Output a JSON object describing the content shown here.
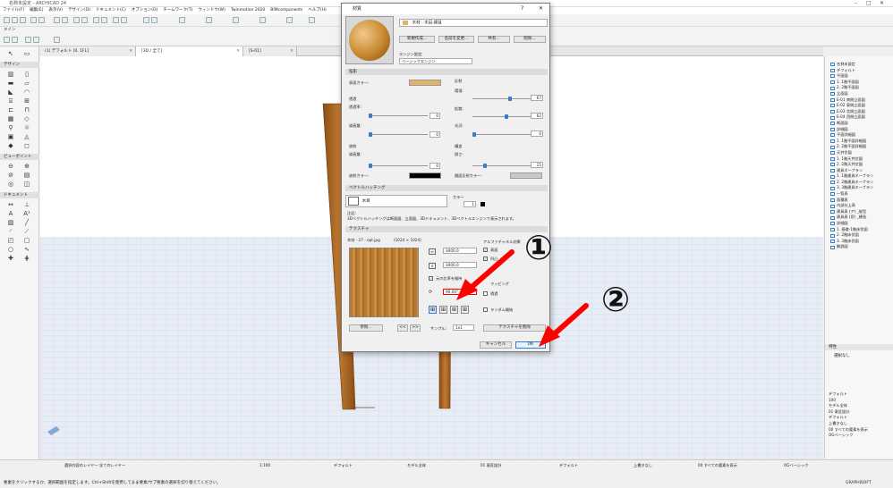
{
  "app": {
    "title": "名称未設定 - ARCHICAD 24"
  },
  "menu": [
    "ファイル(F)",
    "編集(E)",
    "表示(V)",
    "デザイン(D)",
    "ドキュメント(C)",
    "オプション(O)",
    "チームワーク(T)",
    "ウィンドウ(W)",
    "Twinmotion 2020",
    "BIMcomponents",
    "ヘルプ(H)"
  ],
  "toolbar2": {
    "label": "メイン"
  },
  "tabs": [
    {
      "label": "[0. 1FL]",
      "prefix": "(1) デフォルト"
    },
    {
      "label": "[3D / 全て]"
    },
    {
      "label": "[S-01]"
    }
  ],
  "leftpanel": {
    "design": "デザイン",
    "viewpoint": "ビューポイント",
    "document": "ドキュメント"
  },
  "dialog": {
    "title": "材質",
    "material_name": "木材 - 木目-細目",
    "buttons": {
      "new": "新規作成...",
      "rename": "名前を変更...",
      "share": "共有...",
      "delete": "削除..."
    },
    "engine_label": "エンジン設定:",
    "engine_value": "ベーシックエンジン",
    "sections": {
      "appearance": "陰影",
      "hatch": "ベクトルハッチング",
      "texture": "テクスチャ"
    },
    "appearance": {
      "surface_color": "表面カラー:",
      "transparency": "透過",
      "transparency_rate": "透過率:",
      "attenuation": "減衰量:",
      "transparency_val": "0",
      "atten_val": "0",
      "reflection": "反射",
      "glossy": "環境:",
      "glossy_val": "67",
      "diffuse": "拡散:",
      "diffuse_val": "62",
      "specular": "光沢:",
      "specular_val": "0",
      "emission": "放射",
      "emission_atten": "減衰量:",
      "emission_val": "0",
      "emission_color": "放射カラー:",
      "bump": "構造",
      "bump_label": "鋭さ:",
      "bump_val": "15",
      "bump_color": "鏡面反射カラー:"
    },
    "hatch": {
      "type": "木目",
      "pen_label": "カラー",
      "pen_value": "1",
      "note_label": "注記:",
      "note": "3Dベクトルハッチングは断面図、立面図、3Dドキュメント、3Dベクトルエンジンで表示されます。"
    },
    "texture": {
      "filename": "木材 - 27 - opt.jpg",
      "size": "(1024 × 1024)",
      "width": "3000.0",
      "height": "3000.0",
      "keep_ratio": "元の比率を維持",
      "angle": "90.00°",
      "alpha_label": "アルファチャネル効果",
      "alpha_surface": "表面",
      "alpha_bump": "凹凸",
      "alpha_mapping": "マッピング",
      "alpha_transparent": "透過",
      "random": "ランダム開始",
      "browse": "参照...",
      "sample_label": "サンプル:",
      "sample_value": "1x1",
      "remove": "テクスチャを削除"
    },
    "cancel": "キャンセル",
    "ok": "OK"
  },
  "annotations": {
    "one": "①",
    "two": "②"
  },
  "navigator": {
    "items": [
      "名称未設定",
      "デフォルト",
      "平面図",
      "1. 1階平面図",
      "2. 2階平面図",
      "立面図",
      "E-01 南側立面図",
      "E-02 東側立面図",
      "E-03 北側立面図",
      "E-04 西側立面図",
      "断面図",
      "詳細図",
      "平面詳細図",
      "1. 1階平面詳細図",
      "2. 2階平面詳細図",
      "天井伏図",
      "1. 1階天井伏図",
      "2. 2階天井伏図",
      "建具ネーブラン",
      "1. 1階建具ネーブラン",
      "2. 2階建具ネーブラン",
      "3. 3階建具ネーブラン",
      "一覧表",
      "面積表",
      "内部仕上表",
      "建具表 (ア) _縦型",
      "建具表 (窓) _横長",
      "詳細図",
      "1. 基礎-1階床伏図",
      "2. 2階床伏図",
      "3. 3階床伏図",
      "解説図"
    ]
  },
  "props": {
    "title": "特性",
    "value": "選択なし"
  },
  "layers": [
    "デフォルト",
    "100",
    "モデル全体",
    "01 意匠設計",
    "デフォルト",
    "上書きなし",
    "00 すべての要素を表示",
    "OGベーシック"
  ],
  "status": {
    "scale": "1:100",
    "layer": "デフォルト",
    "model": "モデル全体",
    "design": "01 意匠設計",
    "default2": "デフォルト",
    "override": "上書きなし",
    "display": "00 すべての要素を表示",
    "graphics": "OGベーシック",
    "layer_btn": "選択内容のレイヤー:全てのレイヤー",
    "hint": "要素をクリックするか、選択範囲を指定します。Ctrl+Shiftを使用してまま要素/サブ要素の選択を切り替えてください。",
    "brand": "GRAPHISOFT"
  },
  "colors": {
    "accent": "#3a7bc8",
    "surface": "#e0b26a",
    "arrow": "#ff0000",
    "wood": "#b56f2a"
  }
}
